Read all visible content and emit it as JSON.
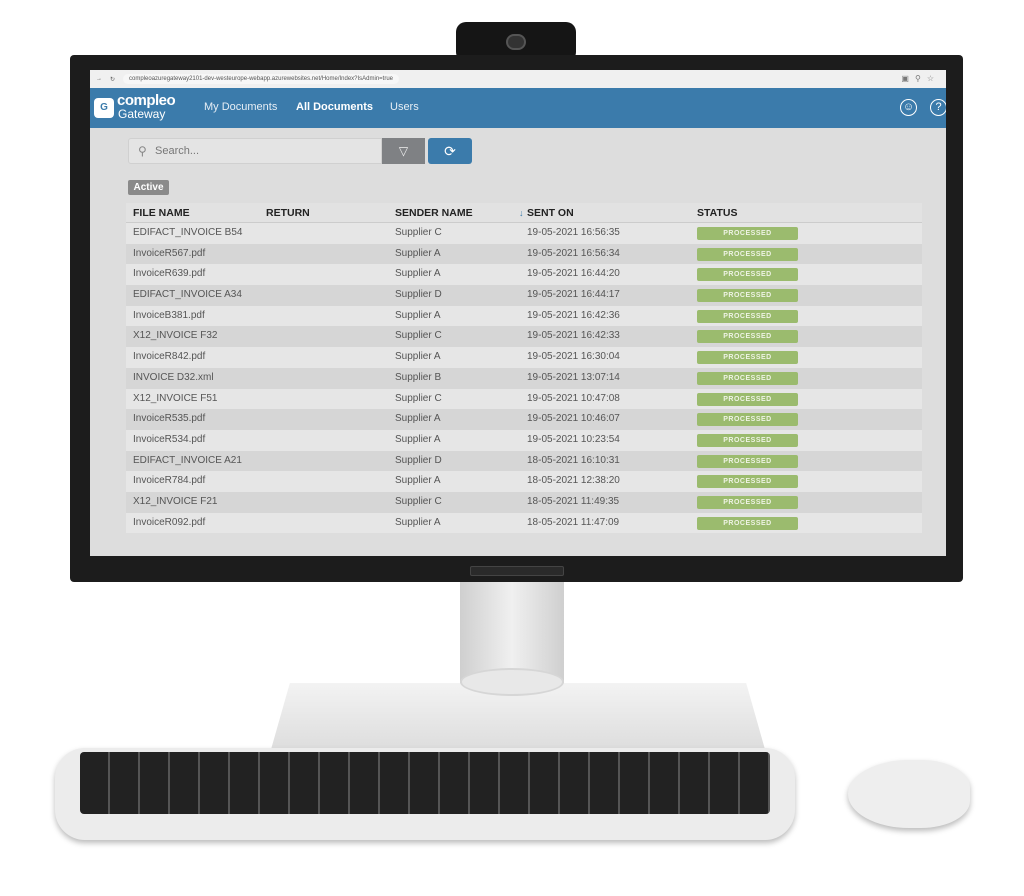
{
  "browser": {
    "url": "compleoazuregateway2101-dev-westeurope-webapp.azurewebsites.net/Home/Index?IsAdmin=true"
  },
  "header": {
    "logo_letter": "G",
    "brand_line1": "compleo",
    "brand_line2": "Gateway",
    "nav": [
      {
        "label": "My Documents"
      },
      {
        "label": "All Documents",
        "active": true
      },
      {
        "label": "Users"
      }
    ],
    "icons": [
      "user-circle-icon",
      "help-icon"
    ],
    "color": "#3b7bab"
  },
  "toolbar": {
    "search_placeholder": "Search...",
    "filter_icon": "filter-icon",
    "refresh_icon": "refresh-icon"
  },
  "filter_badge": "Active",
  "table": {
    "columns": [
      "FILE NAME",
      "RETURN",
      "SENDER NAME",
      "SENT ON",
      "STATUS"
    ],
    "sort_indicator": "↓",
    "rows": [
      [
        "EDIFACT_INVOICE B54",
        "",
        "Supplier C",
        "19-05-2021 16:56:35",
        "PROCESSED"
      ],
      [
        "InvoiceR567.pdf",
        "",
        "Supplier A",
        "19-05-2021 16:56:34",
        "PROCESSED"
      ],
      [
        "InvoiceR639.pdf",
        "",
        "Supplier A",
        "19-05-2021 16:44:20",
        "PROCESSED"
      ],
      [
        "EDIFACT_INVOICE A34",
        "",
        "Supplier D",
        "19-05-2021 16:44:17",
        "PROCESSED"
      ],
      [
        "InvoiceB381.pdf",
        "",
        "Supplier A",
        "19-05-2021 16:42:36",
        "PROCESSED"
      ],
      [
        "X12_INVOICE F32",
        "",
        "Supplier C",
        "19-05-2021 16:42:33",
        "PROCESSED"
      ],
      [
        "InvoiceR842.pdf",
        "",
        "Supplier A",
        "19-05-2021 16:30:04",
        "PROCESSED"
      ],
      [
        "INVOICE D32.xml",
        "",
        "Supplier B",
        "19-05-2021 13:07:14",
        "PROCESSED"
      ],
      [
        "X12_INVOICE F51",
        "",
        "Supplier C",
        "19-05-2021 10:47:08",
        "PROCESSED"
      ],
      [
        "InvoiceR535.pdf",
        "",
        "Supplier A",
        "19-05-2021 10:46:07",
        "PROCESSED"
      ],
      [
        "InvoiceR534.pdf",
        "",
        "Supplier A",
        "19-05-2021 10:23:54",
        "PROCESSED"
      ],
      [
        "EDIFACT_INVOICE A21",
        "",
        "Supplier D",
        "18-05-2021 16:10:31",
        "PROCESSED"
      ],
      [
        "InvoiceR784.pdf",
        "",
        "Supplier A",
        "18-05-2021 12:38:20",
        "PROCESSED"
      ],
      [
        "X12_INVOICE F21",
        "",
        "Supplier C",
        "18-05-2021 11:49:35",
        "PROCESSED"
      ],
      [
        "InvoiceR092.pdf",
        "",
        "Supplier A",
        "18-05-2021 11:47:09",
        "PROCESSED"
      ]
    ],
    "status_color": "#9bbb6e"
  }
}
